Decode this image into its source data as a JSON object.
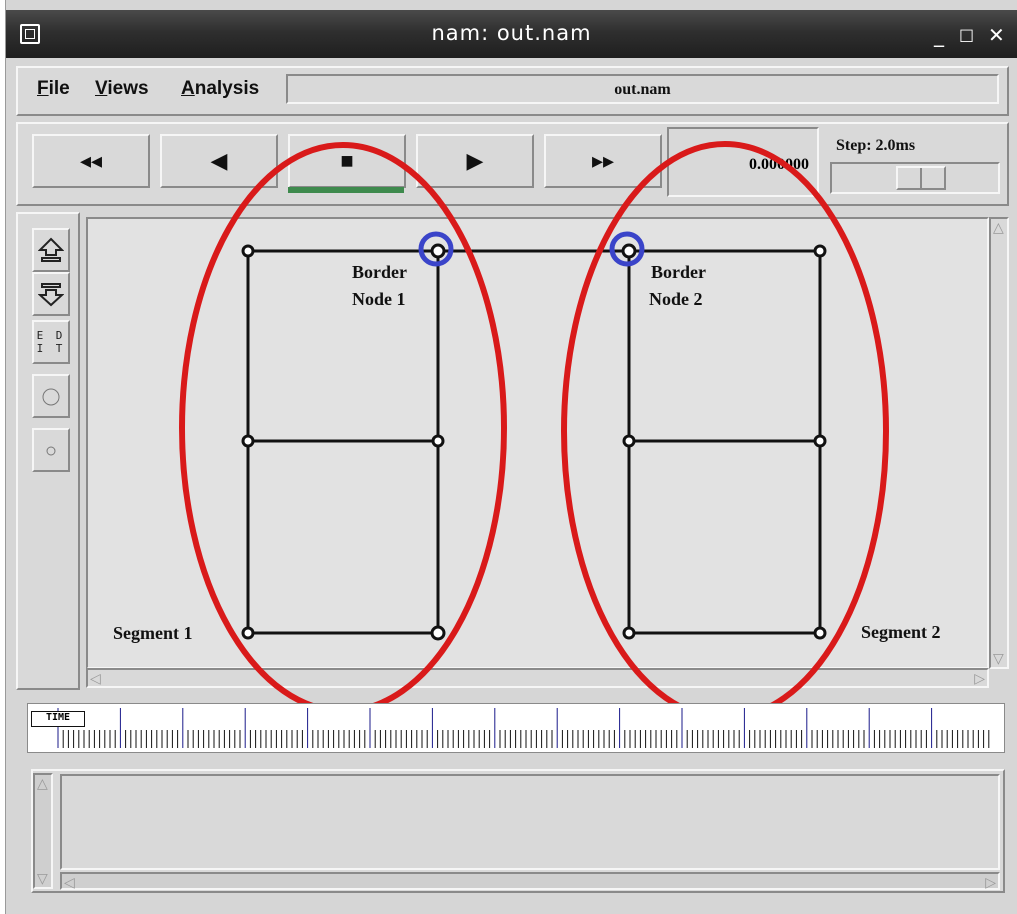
{
  "window": {
    "title": "nam: out.nam",
    "minimize": "_",
    "maximize": "□",
    "close": "✕"
  },
  "menu": {
    "file": "File",
    "views": "Views",
    "analysis": "Analysis",
    "filename": "out.nam"
  },
  "controls": {
    "rewind": "◂◂",
    "back": "◀",
    "stop": "■",
    "play": "▶",
    "fastforward": "▸▸",
    "time_value": "0.000000",
    "step_label": "Step: 2.0ms"
  },
  "tools": {
    "edit": "E D\nI T"
  },
  "canvas": {
    "labels": {
      "border1_line1": "Border",
      "border1_line2": "Node 1",
      "border2_line1": "Border",
      "border2_line2": "Node 2",
      "segment1": "Segment 1",
      "segment2": "Segment 2"
    },
    "annotation_colors": {
      "segment_ellipse": "#d91a1a",
      "border_highlight": "#3a44c9"
    }
  },
  "timeline": {
    "label": "TIME"
  }
}
